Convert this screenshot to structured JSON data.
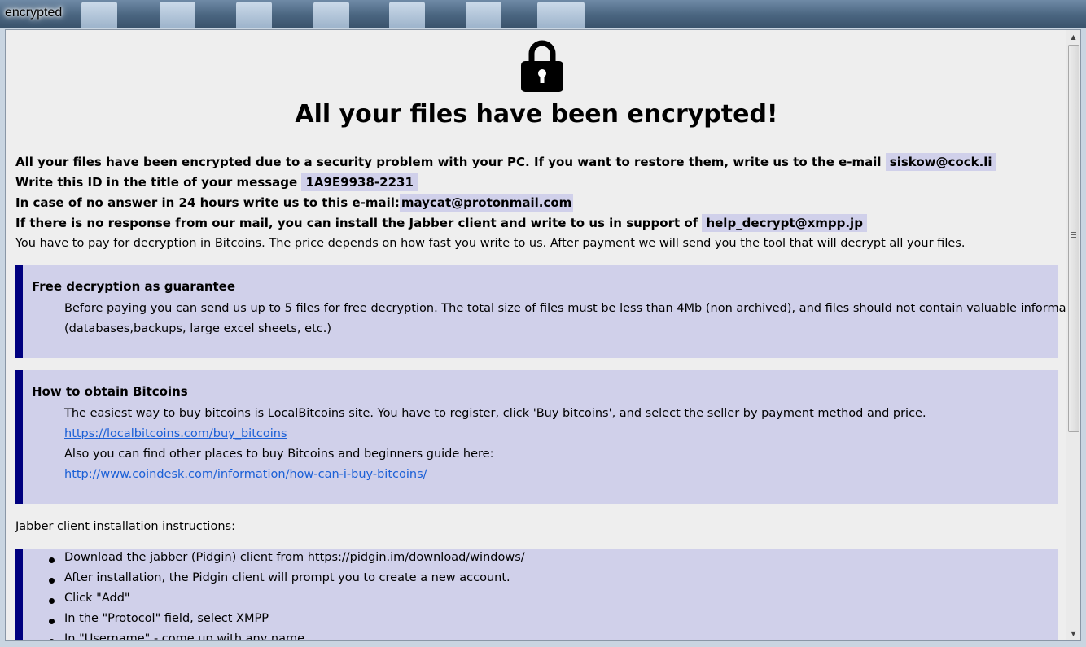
{
  "window": {
    "title": "encrypted"
  },
  "heading": "All your files have been encrypted!",
  "intro": {
    "line1_text": "All your files have been encrypted due to a security problem with your PC. If you want to restore them, write us to the e-mail",
    "line1_email": "siskow@cock.li",
    "line2_text": "Write this ID in the title of your message",
    "line2_id": "1A9E9938-2231",
    "line3_text": "In case of no answer in 24 hours write us to this e-mail:",
    "line3_email": "maycat@protonmail.com",
    "line4_text": "If there is no response from our mail, you can install the Jabber client and write to us in support of",
    "line4_jabber": "help_decrypt@xmpp.jp",
    "line5_text": "You have to pay for decryption in Bitcoins. The price depends on how fast you write to us. After payment we will send you the tool that will decrypt all your files."
  },
  "free_decryption": {
    "title": "Free decryption as guarantee",
    "text1": "Before paying you can send us up to 5 files for free decryption. The total size of files must be less than 4Mb (non archived), and files should not contain valuable information.",
    "text2": "(databases,backups, large excel sheets, etc.)"
  },
  "bitcoins": {
    "title": "How to obtain Bitcoins",
    "text1": "The easiest way to buy bitcoins is LocalBitcoins site. You have to register, click 'Buy bitcoins', and select the seller by payment method and price.",
    "link1": "https://localbitcoins.com/buy_bitcoins",
    "text2": "Also you can find other places to buy Bitcoins and beginners guide here:",
    "link2": "http://www.coindesk.com/information/how-can-i-buy-bitcoins/"
  },
  "jabber": {
    "heading": "Jabber client installation instructions:",
    "steps": [
      "Download the jabber (Pidgin) client from https://pidgin.im/download/windows/",
      "After installation, the Pidgin client will prompt you to create a new account.",
      "Click \"Add\"",
      "In the \"Protocol\" field, select XMPP",
      "In \"Username\" - come up with any name"
    ]
  },
  "icons": {
    "lock": "lock-icon",
    "scroll_up": "scroll-up-arrow-icon",
    "scroll_down": "scroll-down-arrow-icon"
  },
  "colors": {
    "highlight": "#d0d0ea",
    "accent_bar": "#00007f",
    "link": "#1a5fd6"
  }
}
